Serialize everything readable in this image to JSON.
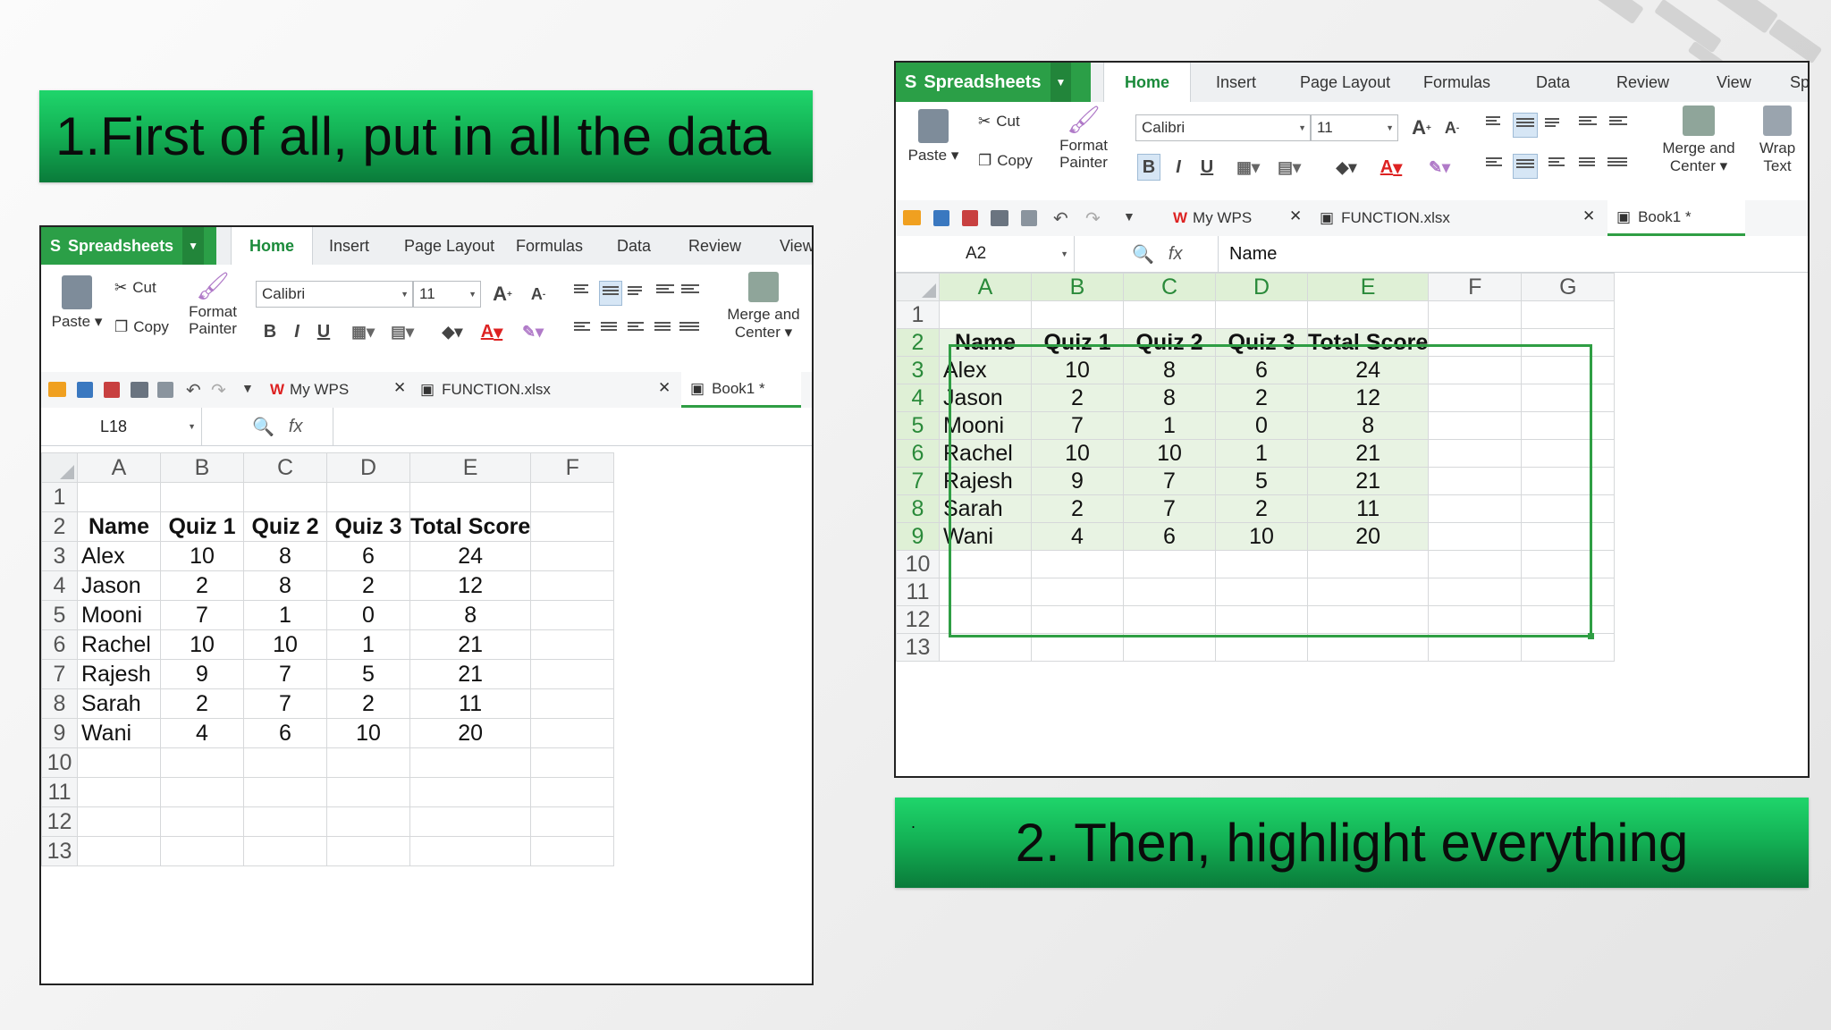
{
  "captions": {
    "step1": "1.First of all, put in all the data",
    "step2": "2. Then, highlight everything",
    "step2_dot": "."
  },
  "app": {
    "brand": "Spreadsheets",
    "tabs": [
      "Home",
      "Insert",
      "Page Layout",
      "Formulas",
      "Data",
      "Review",
      "View"
    ],
    "tabs_overflow": "Sp",
    "ribbon": {
      "paste": "Paste",
      "cut": "Cut",
      "copy": "Copy",
      "format_painter_1": "Format",
      "format_painter_2": "Painter",
      "font": "Calibri",
      "font_size": "11",
      "bold": "B",
      "italic": "I",
      "underline": "U",
      "merge_1": "Merge and",
      "merge_2": "Center",
      "wrap_1": "Wrap",
      "wrap_2": "Text",
      "grow_font": "A",
      "shrink_font": "A",
      "font_color": "A"
    },
    "quick": {
      "mywps": "My WPS",
      "file": "FUNCTION.xlsx",
      "book": "Book1 *"
    },
    "fx_label": "fx"
  },
  "window1": {
    "cell_ref": "L18",
    "formula": ""
  },
  "window2": {
    "cell_ref": "A2",
    "formula": "Name"
  },
  "sheet": {
    "columns1": [
      "A",
      "B",
      "C",
      "D",
      "E",
      "F"
    ],
    "columns2": [
      "A",
      "B",
      "C",
      "D",
      "E",
      "F",
      "G"
    ],
    "row_numbers": [
      "1",
      "2",
      "3",
      "4",
      "5",
      "6",
      "7",
      "8",
      "9",
      "10",
      "11",
      "12",
      "13"
    ],
    "header": [
      "Name",
      "Quiz 1",
      "Quiz 2",
      "Quiz 3",
      "Total Score"
    ],
    "rows": [
      [
        "Alex",
        "10",
        "8",
        "6",
        "24"
      ],
      [
        "Jason",
        "2",
        "8",
        "2",
        "12"
      ],
      [
        "Mooni",
        "7",
        "1",
        "0",
        "8"
      ],
      [
        "Rachel",
        "10",
        "10",
        "1",
        "21"
      ],
      [
        "Rajesh",
        "9",
        "7",
        "5",
        "21"
      ],
      [
        "Sarah",
        "2",
        "7",
        "2",
        "11"
      ],
      [
        "Wani",
        "4",
        "6",
        "10",
        "20"
      ]
    ]
  },
  "colors": {
    "banner_green": "#14b356",
    "brand_green": "#2b9f47",
    "selection_green": "#2f9e44"
  }
}
